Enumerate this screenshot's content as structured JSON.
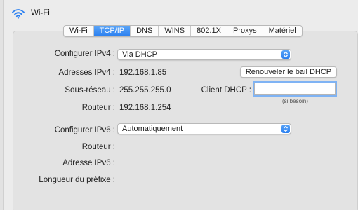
{
  "header": {
    "title": "Wi-Fi",
    "icon": "wifi-icon"
  },
  "tabs": [
    {
      "label": "Wi-Fi",
      "active": false
    },
    {
      "label": "TCP/IP",
      "active": true
    },
    {
      "label": "DNS",
      "active": false
    },
    {
      "label": "WINS",
      "active": false
    },
    {
      "label": "802.1X",
      "active": false
    },
    {
      "label": "Proxys",
      "active": false
    },
    {
      "label": "Matériel",
      "active": false
    }
  ],
  "ipv4": {
    "configure_label": "Configurer IPv4 :",
    "configure_value": "Via DHCP",
    "address_label": "Adresses IPv4 :",
    "address_value": "192.168.1.85",
    "subnet_label": "Sous-réseau :",
    "subnet_value": "255.255.255.0",
    "router_label": "Routeur :",
    "router_value": "192.168.1.254",
    "renew_button": "Renouveler le bail DHCP",
    "client_dhcp_label": "Client DHCP :",
    "client_dhcp_value": "",
    "client_dhcp_hint": "(si besoin)"
  },
  "ipv6": {
    "configure_label": "Configurer IPv6 :",
    "configure_value": "Automatiquement",
    "router_label": "Routeur :",
    "address_label": "Adresse IPv6 :",
    "prefix_label": "Longueur du préfixe :"
  },
  "colors": {
    "accent": "#2a7ff0",
    "panel": "#e3e3e3",
    "window": "#ececec"
  }
}
